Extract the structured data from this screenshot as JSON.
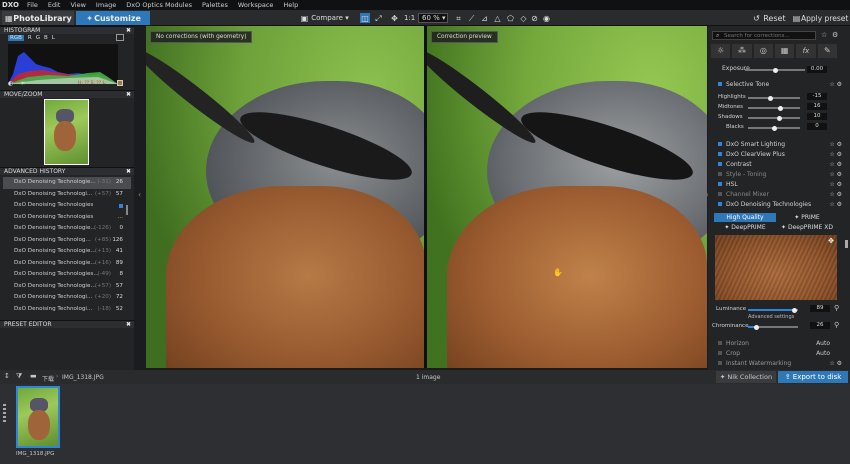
{
  "app": {
    "logo": "DXO"
  },
  "menu": [
    "File",
    "Edit",
    "View",
    "Image",
    "DxO Optics Modules",
    "Palettes",
    "Workspace",
    "Help"
  ],
  "tabs": {
    "library": "PhotoLibrary",
    "customize": "Customize"
  },
  "toolbar": {
    "compare": "Compare",
    "ratio": "1:1",
    "zoom": "60 %",
    "reset": "Reset",
    "apply_preset": "Apply preset"
  },
  "left": {
    "histogram_title": "HISTOGRAM",
    "channels": [
      "RGB",
      "R",
      "G",
      "B",
      "L"
    ],
    "histo_readout": "H: ?? S: ?? L:",
    "movezoom_title": "MOVE/ZOOM",
    "history_title": "ADVANCED HISTORY",
    "history": [
      {
        "label": "DxO Denoising Technologie...",
        "delta": "(-31)",
        "value": "26"
      },
      {
        "label": "DxO Denoising Technologi...",
        "delta": "(+57)",
        "value": "57"
      },
      {
        "label": "DxO Denoising Technologies",
        "delta": "",
        "value": ""
      },
      {
        "label": "DxO Denoising Technologies",
        "delta": "",
        "value": "..."
      },
      {
        "label": "DxO Denoising Technologie...",
        "delta": "(-126)",
        "value": "0"
      },
      {
        "label": "DxO Denoising Technolog...",
        "delta": "(+85)",
        "value": "126"
      },
      {
        "label": "DxO Denoising Technologie...",
        "delta": "(+13)",
        "value": "41"
      },
      {
        "label": "DxO Denoising Technologie...",
        "delta": "(+16)",
        "value": "89"
      },
      {
        "label": "DxO Denoising Technologies...",
        "delta": "(-49)",
        "value": "8"
      },
      {
        "label": "DxO Denoising Technologie...",
        "delta": "(+57)",
        "value": "57"
      },
      {
        "label": "DxO Denoising Technologi...",
        "delta": "(+20)",
        "value": "72"
      },
      {
        "label": "DxO Denoising Technologi...",
        "delta": "(-18)",
        "value": "52"
      }
    ],
    "preset_title": "PRESET EDITOR"
  },
  "viewer": {
    "left_label": "No corrections (with geometry)",
    "right_label": "Correction preview"
  },
  "right": {
    "search_placeholder": "Search for corrections...",
    "exposure": {
      "label": "Exposure",
      "value": "0.00"
    },
    "selective_tone": "Selective Tone",
    "tone": [
      {
        "label": "Highlights",
        "value": "-15"
      },
      {
        "label": "Midtones",
        "value": "16"
      },
      {
        "label": "Shadows",
        "value": "10"
      },
      {
        "label": "Blacks",
        "value": "0"
      }
    ],
    "modules": [
      "DxO Smart Lighting",
      "DxO ClearView Plus",
      "Contrast",
      "Style - Toning",
      "HSL",
      "Channel Mixer",
      "DxO Denoising Technologies"
    ],
    "denoise": {
      "hq": "High Quality",
      "prime": "PRIME",
      "deepprime": "DeepPRIME",
      "deepprimexd": "DeepPRIME XD"
    },
    "luminance": {
      "label": "Luminance",
      "value": "89"
    },
    "advanced": "Advanced settings",
    "chrominance": {
      "label": "Chrominance",
      "value": "26"
    },
    "bottom": [
      {
        "label": "Horizon",
        "state": "Auto"
      },
      {
        "label": "Crop",
        "state": "Auto"
      },
      {
        "label": "Instant Watermarking",
        "state": ""
      }
    ]
  },
  "filmbar": {
    "folder": "下载",
    "file": "IMG_1318.JPG",
    "count": "1 image",
    "nik": "Nik Collection",
    "export": "Export to disk"
  },
  "thumb": {
    "name": "IMG_1318.JPG"
  }
}
